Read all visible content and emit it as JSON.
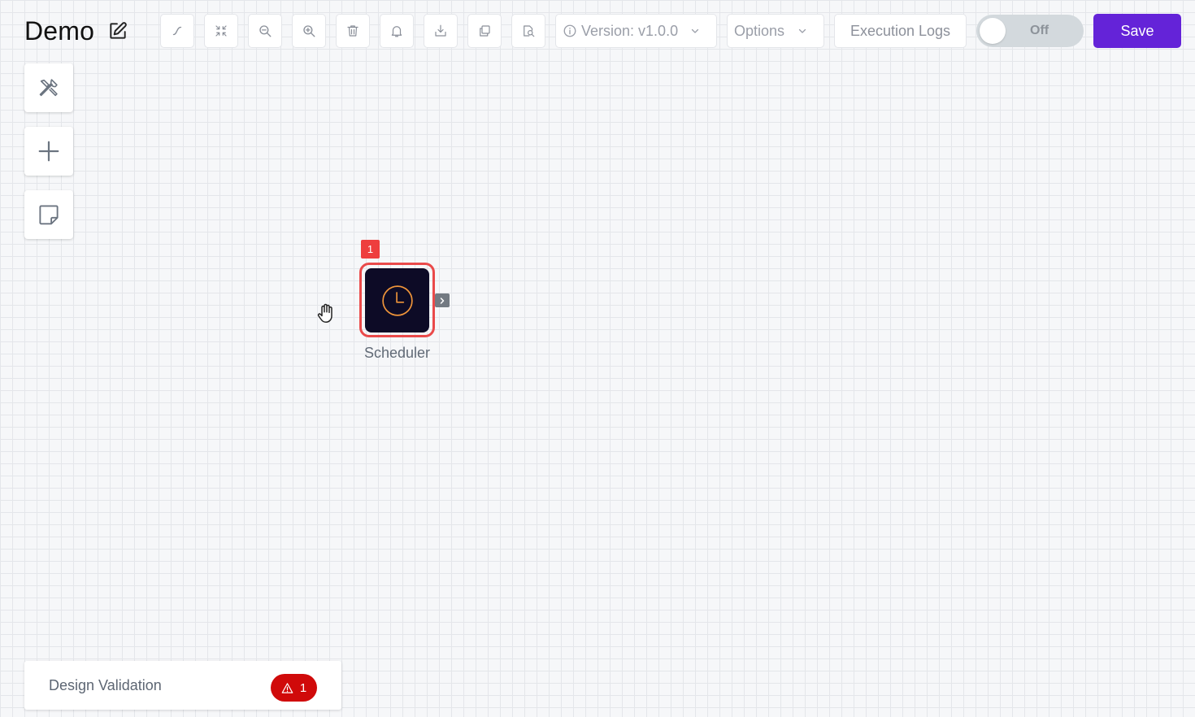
{
  "header": {
    "title": "Demo",
    "version_label": "Version: v1.0.0",
    "options_label": "Options",
    "execution_logs_label": "Execution Logs",
    "save_label": "Save",
    "toggle_label": "Off",
    "toggle_on": false
  },
  "toolbar": {
    "tools": [
      "connect-line-icon",
      "fit-screen-icon",
      "zoom-out-icon",
      "zoom-in-icon",
      "delete-icon",
      "notifications-icon",
      "download-icon",
      "duplicate-icon",
      "preview-icon"
    ]
  },
  "side_tools": [
    "tools-icon",
    "plus-icon",
    "sticky-note-icon"
  ],
  "node": {
    "label": "Scheduler",
    "badge_count": "1",
    "icon": "clock-icon",
    "accent": "#f0953a",
    "error_border": "#ea4a4a"
  },
  "validation": {
    "title": "Design Validation",
    "count": "1"
  },
  "colors": {
    "brand": "#6423d8",
    "error": "#d00a0a",
    "node_background": "#0d0b26"
  }
}
